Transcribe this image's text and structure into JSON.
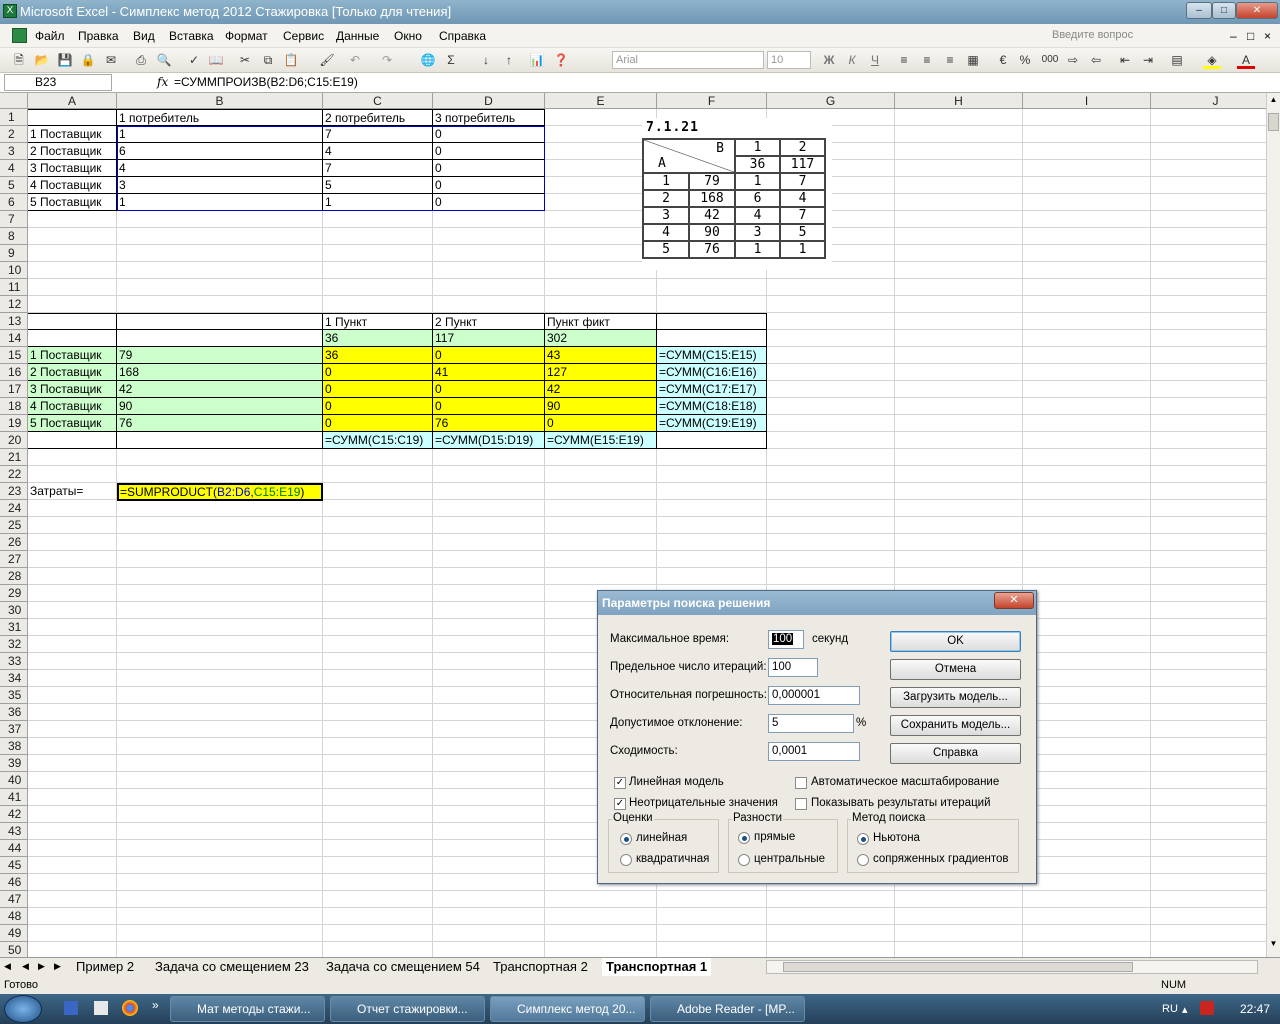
{
  "window": {
    "title": "Microsoft Excel - Симплекс метод 2012 Стажировка  [Только для чтения]",
    "doc_controls": [
      "–",
      "□",
      "×"
    ]
  },
  "menu": {
    "items": [
      "Файл",
      "Правка",
      "Вид",
      "Вставка",
      "Формат",
      "Сервис",
      "Данные",
      "Окно",
      "Справка"
    ],
    "help_placeholder": "Введите вопрос"
  },
  "toolbar": {
    "font_name": "Arial",
    "font_size": "10",
    "bold": "Ж",
    "italic": "К",
    "underline": "Ч",
    "percent": "%",
    "thousands": "000"
  },
  "formula_bar": {
    "name_box": "B23",
    "fx": "fx",
    "formula": "=СУММПРОИЗВ(B2:D6;C15:E19)"
  },
  "grid": {
    "columns": [
      "A",
      "B",
      "C",
      "D",
      "E",
      "F",
      "G",
      "H",
      "I",
      "J"
    ],
    "rows": [
      "1",
      "2",
      "3",
      "4",
      "5",
      "6",
      "7",
      "8",
      "9",
      "10",
      "11",
      "12",
      "13",
      "14",
      "15",
      "16",
      "17",
      "18",
      "19",
      "20",
      "21",
      "22",
      "23",
      "24",
      "25",
      "26",
      "27",
      "28",
      "29",
      "30",
      "31",
      "32",
      "33",
      "34",
      "35",
      "36",
      "37",
      "38",
      "39",
      "40",
      "41",
      "42",
      "43",
      "44",
      "45",
      "46",
      "47",
      "48",
      "49",
      "50"
    ],
    "cells": {
      "B1": "1 потребитель",
      "C1": "2 потребитель",
      "D1": "3 потребитель",
      "A2": "1 Поставщик",
      "B2": "1",
      "C2": "7",
      "D2": "0",
      "A3": "2 Поставщик",
      "B3": "6",
      "C3": "4",
      "D3": "0",
      "A4": "3 Поставщик",
      "B4": "4",
      "C4": "7",
      "D4": "0",
      "A5": "4 Поставщик",
      "B5": "3",
      "C5": "5",
      "D5": "0",
      "A6": "5 Поставщик",
      "B6": "1",
      "C6": "1",
      "D6": "0",
      "C13": "1 Пункт",
      "D13": "2 Пункт",
      "E13": "Пункт фикт",
      "C14": "36",
      "D14": "117",
      "E14": "302",
      "A15": "1 Поставщик",
      "B15": "79",
      "C15": "36",
      "D15": "0",
      "E15": "43",
      "F15": "=СУММ(C15:E15)",
      "A16": "2 Поставщик",
      "B16": "168",
      "C16": "0",
      "D16": "41",
      "E16": "127",
      "F16": "=СУММ(C16:E16)",
      "A17": "3 Поставщик",
      "B17": "42",
      "C17": "0",
      "D17": "0",
      "E17": "42",
      "F17": "=СУММ(C17:E17)",
      "A18": "4 Поставщик",
      "B18": "90",
      "C18": "0",
      "D18": "0",
      "E18": "90",
      "F18": "=СУММ(C18:E18)",
      "A19": "5 Поставщик",
      "B19": "76",
      "C19": "0",
      "D19": "76",
      "E19": "0",
      "F19": "=СУММ(C19:E19)",
      "C20": "=СУММ(C15:C19)",
      "D20": "=СУММ(D15:D19)",
      "E20": "=СУММ(E15:E19)",
      "A23": "Затраты="
    },
    "b23_parts": [
      "=SUMPRODUCT(",
      "B2:D6",
      ",",
      "C15:E19",
      ")"
    ]
  },
  "scan_table": {
    "title": "7.1.21",
    "header_bj": "B",
    "header_ai": "A",
    "col_nums": [
      "1",
      "2"
    ],
    "demand": [
      "36",
      "117"
    ],
    "rows": [
      [
        "1",
        "79",
        "1",
        "7"
      ],
      [
        "2",
        "168",
        "6",
        "4"
      ],
      [
        "3",
        "42",
        "4",
        "7"
      ],
      [
        "4",
        "90",
        "3",
        "5"
      ],
      [
        "5",
        "76",
        "1",
        "1"
      ]
    ]
  },
  "dialog": {
    "title": "Параметры поиска решения",
    "max_time_label": "Максимальное время:",
    "max_time_value": "100",
    "seconds": "секунд",
    "iter_label": "Предельное число итераций:",
    "iter_value": "100",
    "precision_label": "Относительная погрешность:",
    "precision_value": "0,000001",
    "tolerance_label": "Допустимое отклонение:",
    "tolerance_value": "5",
    "percent": "%",
    "convergence_label": "Сходимость:",
    "convergence_value": "0,0001",
    "btn_ok": "OK",
    "btn_cancel": "Отмена",
    "btn_load": "Загрузить модель...",
    "btn_save": "Сохранить модель...",
    "btn_help": "Справка",
    "chk_linear": "Линейная модель",
    "chk_nonneg": "Неотрицательные значения",
    "chk_autoscale": "Автоматическое масштабирование",
    "chk_show_iter": "Показывать результаты итераций",
    "grp_estimates": "Оценки",
    "est_linear": "линейная",
    "est_quadratic": "квадратичная",
    "grp_derivatives": "Разности",
    "der_forward": "прямые",
    "der_central": "центральные",
    "grp_search": "Метод поиска",
    "search_newton": "Ньютона",
    "search_conjugate": "сопряженных градиентов"
  },
  "sheet_tabs": [
    "Пример 2",
    "Задача со смещением 23",
    "Задача со смещением 54",
    "Транспортная 2",
    "Транспортная 1"
  ],
  "status": {
    "left": "Готово",
    "num": "NUM"
  },
  "taskbar": {
    "items": [
      "Мат методы стажи...",
      "Отчет стажировки...",
      "Симплекс метод 20...",
      "Adobe Reader - [MP..."
    ],
    "lang": "RU",
    "time": "22:47"
  },
  "colors": {
    "green": "#ccffcc",
    "yellow": "#ffff00",
    "cyan": "#ccffff",
    "blue_border": "#0000cc"
  }
}
